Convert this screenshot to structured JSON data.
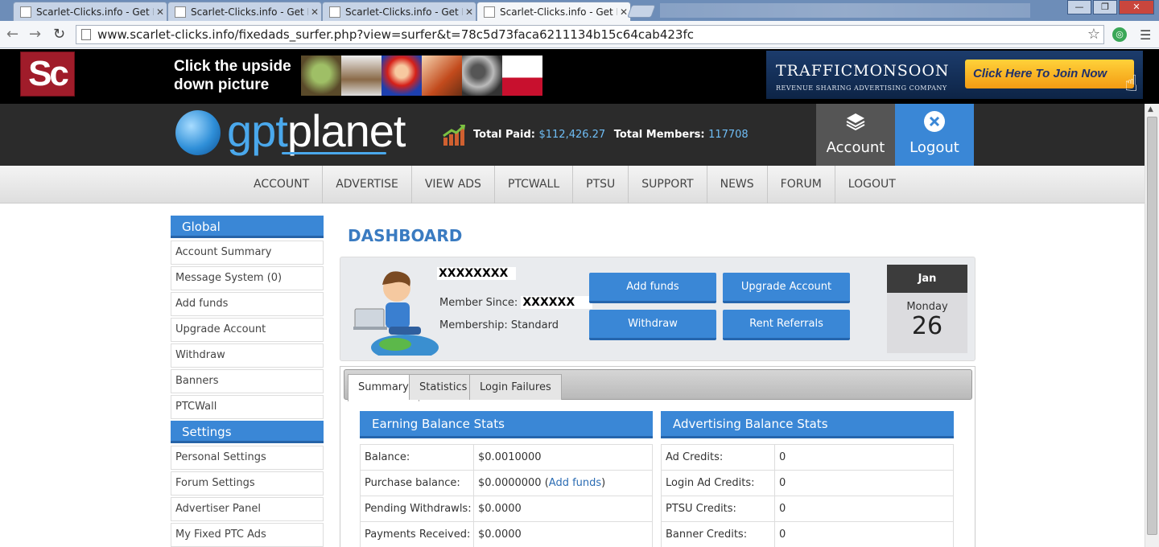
{
  "browser": {
    "tabs": [
      {
        "title": "Scarlet-Clicks.info - Get Pa"
      },
      {
        "title": "Scarlet-Clicks.info - Get Pa"
      },
      {
        "title": "Scarlet-Clicks.info - Get Pa"
      },
      {
        "title": "Scarlet-Clicks.info - Get Pa"
      }
    ],
    "url": "www.scarlet-clicks.info/fixedads_surfer.php?view=surfer&t=78c5d73faca6211134b15c64cab423fc"
  },
  "banner": {
    "logo_text": "Sc",
    "upside_line1": "Click the upside",
    "upside_line2": "down picture",
    "traffic_title": "TRAFFICMONSOON",
    "traffic_subtitle": "REVENUE SHARING ADVERTISING COMPANY",
    "join_label": "Click Here To Join Now"
  },
  "header": {
    "logo_a": "gpt",
    "logo_b": "planet",
    "total_paid_label": "Total Paid:",
    "total_paid_value": "$112,426.27",
    "total_members_label": "Total Members:",
    "total_members_value": "117708",
    "account_label": "Account",
    "logout_label": "Logout"
  },
  "nav": [
    "ACCOUNT",
    "ADVERTISE",
    "VIEW ADS",
    "PTCWALL",
    "PTSU",
    "SUPPORT",
    "NEWS",
    "FORUM",
    "LOGOUT"
  ],
  "sidebar": {
    "global_title": "Global",
    "global_items": [
      "Account Summary",
      "Message System (0)",
      "Add funds",
      "Upgrade Account",
      "Withdraw",
      "Banners",
      "PTCWall"
    ],
    "settings_title": "Settings",
    "settings_items": [
      "Personal Settings",
      "Forum Settings",
      "Advertiser Panel",
      "My Fixed PTC Ads"
    ]
  },
  "dashboard": {
    "title": "DASHBOARD",
    "username": "XXXXXXXX",
    "member_since_label": "Member Since:",
    "member_since_value": "XXXXXX",
    "membership": "Membership: Standard",
    "buttons": {
      "add_funds": "Add funds",
      "upgrade": "Upgrade Account",
      "withdraw": "Withdraw",
      "rent": "Rent Referrals"
    },
    "calendar": {
      "month": "Jan",
      "weekday": "Monday",
      "day": "26"
    }
  },
  "tabs": [
    "Summary",
    "Statistics",
    "Login Failures"
  ],
  "earning": {
    "title": "Earning Balance Stats",
    "rows": [
      {
        "label": "Balance:",
        "value": "$0.0010000"
      },
      {
        "label": "Purchase balance:",
        "value": "$0.0000000 (",
        "link": "Add funds",
        "after": ")"
      },
      {
        "label": "Pending Withdrawls:",
        "value": "$0.0000"
      },
      {
        "label": "Payments Received:",
        "value": "$0.0000"
      }
    ]
  },
  "advertising": {
    "title": "Advertising Balance Stats",
    "rows": [
      {
        "label": "Ad Credits:",
        "value": "0"
      },
      {
        "label": "Login Ad Credits:",
        "value": "0"
      },
      {
        "label": "PTSU Credits:",
        "value": "0"
      },
      {
        "label": "Banner Credits:",
        "value": "0"
      }
    ]
  }
}
